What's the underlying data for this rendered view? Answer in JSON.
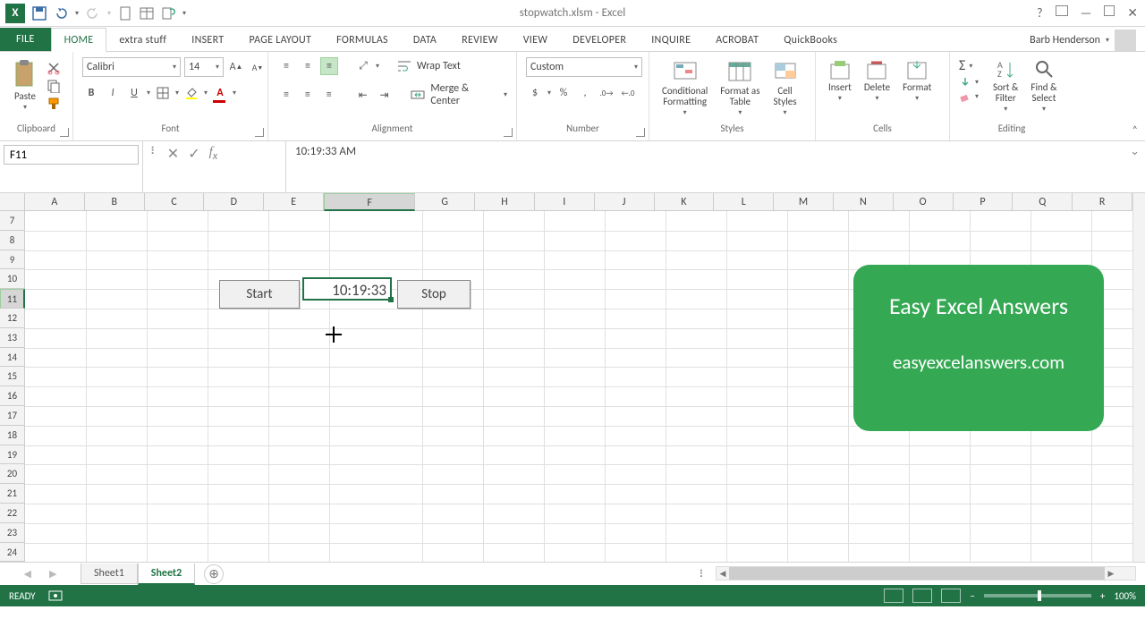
{
  "title": "stopwatch.xlsm - Excel",
  "user": "Barb Henderson",
  "tabs": {
    "file": "FILE",
    "home": "HOME",
    "extra": "extra stuff",
    "insert": "INSERT",
    "pagelayout": "PAGE LAYOUT",
    "formulas": "FORMULAS",
    "data": "DATA",
    "review": "REVIEW",
    "view": "VIEW",
    "developer": "DEVELOPER",
    "inquire": "INQUIRE",
    "acrobat": "ACROBAT",
    "quickbooks": "QuickBooks"
  },
  "ribbon": {
    "clipboard": {
      "paste": "Paste",
      "label": "Clipboard"
    },
    "font": {
      "name": "Calibri",
      "size": "14",
      "label": "Font"
    },
    "alignment": {
      "wrap": "Wrap Text",
      "merge": "Merge & Center",
      "label": "Alignment"
    },
    "number": {
      "format": "Custom",
      "label": "Number"
    },
    "styles": {
      "cond": "Conditional\nFormatting",
      "table": "Format as\nTable",
      "cell": "Cell\nStyles",
      "label": "Styles"
    },
    "cells": {
      "insert": "Insert",
      "delete": "Delete",
      "format": "Format",
      "label": "Cells"
    },
    "editing": {
      "sort": "Sort &\nFilter",
      "find": "Find &\nSelect",
      "label": "Editing"
    }
  },
  "namebox": "F11",
  "formula": "10:19:33 AM",
  "columns": [
    "A",
    "B",
    "C",
    "D",
    "E",
    "F",
    "G",
    "H",
    "I",
    "J",
    "K",
    "L",
    "M",
    "N",
    "O",
    "P",
    "Q",
    "R"
  ],
  "rows": [
    "7",
    "8",
    "9",
    "10",
    "11",
    "12",
    "13",
    "14",
    "15",
    "16",
    "17",
    "18",
    "19",
    "20",
    "21",
    "22",
    "23",
    "24"
  ],
  "selectedCol": "F",
  "selectedRow": "11",
  "buttons": {
    "start": "Start",
    "stop": "Stop"
  },
  "cellValue": "10:19:33",
  "promo": {
    "title": "Easy  Excel  Answers",
    "url": "easyexcelanswers.com"
  },
  "sheets": {
    "s1": "Sheet1",
    "s2": "Sheet2"
  },
  "status": {
    "ready": "READY",
    "zoom": "100%"
  }
}
